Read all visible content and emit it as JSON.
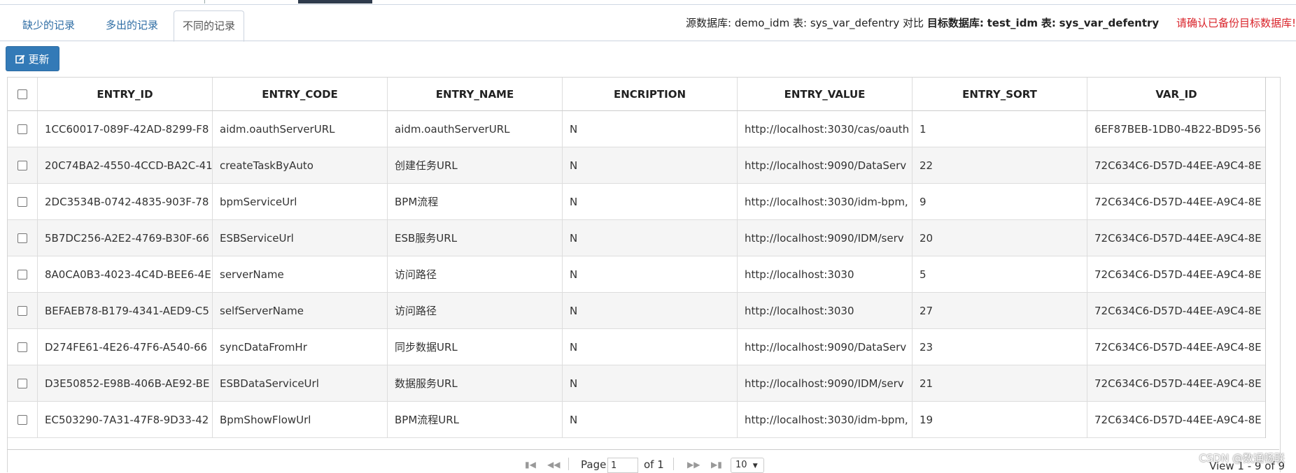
{
  "tabs": [
    {
      "label": "缺少的记录",
      "active": false
    },
    {
      "label": "多出的记录",
      "active": false
    },
    {
      "label": "不同的记录",
      "active": true
    }
  ],
  "db_info": {
    "source_label": "源数据库:",
    "source_db": "demo_idm",
    "source_table_label": "表:",
    "source_table": "sys_var_defentry",
    "compare_label": "对比",
    "target_label": "目标数据库:",
    "target_db": "test_idm",
    "target_table_label": "表:",
    "target_table": "sys_var_defentry",
    "warning": "请确认已备份目标数据库!",
    "warning_color": "#d9232a"
  },
  "toolbar": {
    "update_label": "更新",
    "accent": "#337ab7"
  },
  "grid": {
    "columns": [
      "ENTRY_ID",
      "ENTRY_CODE",
      "ENTRY_NAME",
      "ENCRIPTION",
      "ENTRY_VALUE",
      "ENTRY_SORT",
      "VAR_ID"
    ],
    "rows": [
      [
        "1CC60017-089F-42AD-8299-F8",
        "aidm.oauthServerURL",
        "aidm.oauthServerURL",
        "N",
        "http://localhost:3030/cas/oauth",
        "1",
        "6EF87BEB-1DB0-4B22-BD95-56"
      ],
      [
        "20C74BA2-4550-4CCD-BA2C-41",
        "createTaskByAuto",
        "创建任务URL",
        "N",
        "http://localhost:9090/DataServ",
        "22",
        "72C634C6-D57D-44EE-A9C4-8E"
      ],
      [
        "2DC3534B-0742-4835-903F-78",
        "bpmServiceUrl",
        "BPM流程",
        "N",
        "http://localhost:3030/idm-bpm,",
        "9",
        "72C634C6-D57D-44EE-A9C4-8E"
      ],
      [
        "5B7DC256-A2E2-4769-B30F-66",
        "ESBServiceUrl",
        "ESB服务URL",
        "N",
        "http://localhost:9090/IDM/serv",
        "20",
        "72C634C6-D57D-44EE-A9C4-8E"
      ],
      [
        "8A0CA0B3-4023-4C4D-BEE6-4E",
        "serverName",
        "访问路径",
        "N",
        "http://localhost:3030",
        "5",
        "72C634C6-D57D-44EE-A9C4-8E"
      ],
      [
        "BEFAEB78-B179-4341-AED9-C5",
        "selfServerName",
        "访问路径",
        "N",
        "http://localhost:3030",
        "27",
        "72C634C6-D57D-44EE-A9C4-8E"
      ],
      [
        "D274FE61-4E26-47F6-A540-66",
        "syncDataFromHr",
        "同步数据URL",
        "N",
        "http://localhost:9090/DataServ",
        "23",
        "72C634C6-D57D-44EE-A9C4-8E"
      ],
      [
        "D3E50852-E98B-406B-AE92-BE",
        "ESBDataServiceUrl",
        "数据服务URL",
        "N",
        "http://localhost:9090/IDM/serv",
        "21",
        "72C634C6-D57D-44EE-A9C4-8E"
      ],
      [
        "EC503290-7A31-47F8-9D33-42",
        "BpmShowFlowUrl",
        "BPM流程URL",
        "N",
        "http://localhost:3030/idm-bpm,",
        "19",
        "72C634C6-D57D-44EE-A9C4-8E"
      ]
    ]
  },
  "pager": {
    "page_label": "Page",
    "page_value": "1",
    "of_label": "of 1",
    "page_size": "10",
    "view_text": "View 1 - 9 of 9"
  },
  "watermark": "CSDN @数通畅联"
}
